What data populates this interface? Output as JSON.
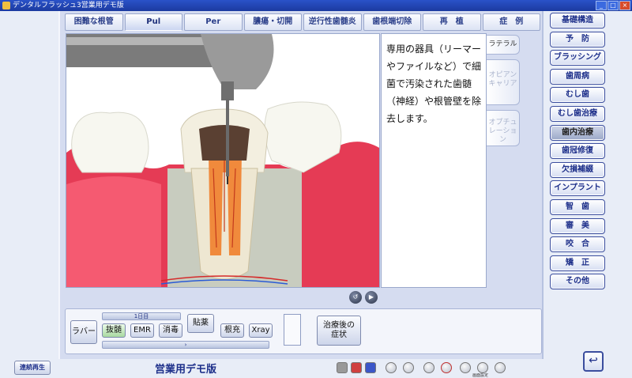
{
  "window": {
    "title": "デンタルフラッシュ3営業用デモ版",
    "controls": [
      "_",
      "□",
      "×"
    ]
  },
  "tabs": [
    "困難な根管",
    "Pul",
    "Per",
    "膿瘍・切開",
    "逆行性歯髄炎",
    "歯根端切除",
    "再　植",
    "症　例"
  ],
  "active_tab": "Pul",
  "description": "専用の器具（リーマーやファイルなど）で細菌で汚染された歯髄（神経）や根管壁を除去します。",
  "side_tabs": [
    "ラテラル",
    "オピアンキャリア",
    "オプチュレーション"
  ],
  "bottom": {
    "rubber": "ラバー",
    "day1": "1日目",
    "steps": [
      "抜髄",
      "EMR",
      "消毒",
      "貼薬",
      "根充",
      "Xray"
    ],
    "after": "治療後の症状"
  },
  "right_menu": [
    "基礎構造",
    "予　防",
    "ブラッシング",
    "歯周病",
    "むし歯",
    "むし歯治療",
    "歯内治療",
    "歯冠修復",
    "欠損補綴",
    "インプラント",
    "智　歯",
    "審　美",
    "咬　合",
    "矯　正",
    "その他"
  ],
  "right_active": "歯内治療",
  "footer": {
    "play": "連続再生",
    "mode": "営業用デモ版",
    "sub": "画面設定"
  }
}
